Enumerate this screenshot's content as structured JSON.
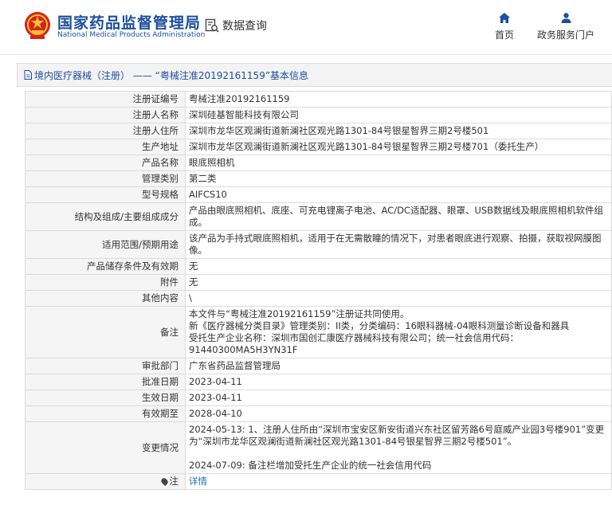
{
  "header": {
    "logo_cn": "国家药品监督管理局",
    "logo_en": "National Medical Products Administration",
    "query_label": "数据查询",
    "nav_home": "首页",
    "nav_portal": "政务服务门户"
  },
  "colors": {
    "brand_blue": "#1b4f9c",
    "link": "#1b6fc4",
    "emblem_red": "#d7231b",
    "emblem_gold": "#f2c230"
  },
  "title": "境内医疗器械（注册） —— “粤械注准20192161159”基本信息",
  "rows": [
    {
      "k": "注册证编号",
      "v": "粤械注准20192161159"
    },
    {
      "k": "注册人名称",
      "v": "深圳硅基智能科技有限公司"
    },
    {
      "k": "注册人住所",
      "v": "深圳市龙华区观澜街道新澜社区观光路1301-84号银星智界三期2号楼501"
    },
    {
      "k": "生产地址",
      "v": "深圳市龙华区观澜街道新澜社区观光路1301-84号银星智界三期2号楼701（委托生产）"
    },
    {
      "k": "产品名称",
      "v": "眼底照相机"
    },
    {
      "k": "管理类别",
      "v": "第二类"
    },
    {
      "k": "型号规格",
      "v": "AIFCS10"
    },
    {
      "k": "结构及组成/主要组成成分",
      "v": "产品由眼底照相机、底座、可充电锂离子电池、AC/DC适配器、眼罩、USB数据线及眼底照相机软件组成。"
    },
    {
      "k": "适用范围/预期用途",
      "v": "该产品为手持式眼底照相机，适用于在无需散瞳的情况下，对患者眼底进行观察、拍摄，获取视网膜图像。"
    },
    {
      "k": "产品储存条件及有效期",
      "v": "无"
    },
    {
      "k": "附件",
      "v": "无"
    },
    {
      "k": "其他内容",
      "v": "\\"
    },
    {
      "k": "备注",
      "v": "本文件与“粤械注准20192161159”注册证共同使用。\n新《医疗器械分类目录》管理类别：II类，分类编码：16眼科器械-04眼科测量诊断设备和器具\n受托生产企业名称：深圳市国创汇康医疗器械科技有限公司；统一社会信用代码：91440300MA5H3YN31F"
    },
    {
      "k": "审批部门",
      "v": "广东省药品监督管理局"
    },
    {
      "k": "批准日期",
      "v": "2023-04-11"
    },
    {
      "k": "生效日期",
      "v": "2023-04-11"
    },
    {
      "k": "有效期至",
      "v": "2028-04-10"
    },
    {
      "k": "变更情况",
      "v": "2024-05-13: 1、注册人住所由“深圳市宝安区新安街道兴东社区留芳路6号庭威产业园3号楼901”变更为“深圳市龙华区观澜街道新澜社区观光路1301-84号银星智界三期2号楼501”。\n\n2024-07-09: 备注栏增加受托生产企业的统一社会信用代码"
    }
  ],
  "note_row": {
    "k": "注",
    "v": "详情",
    "icon": "pin-icon"
  }
}
